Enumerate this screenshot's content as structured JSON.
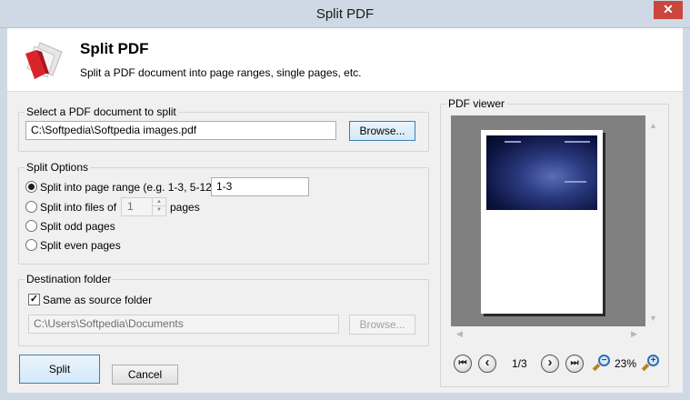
{
  "window": {
    "title": "Split PDF",
    "close_glyph": "✕"
  },
  "header": {
    "title": "Split PDF",
    "subtitle": "Split a PDF document into page ranges, single pages, etc."
  },
  "source": {
    "group_label": "Select a PDF document to split",
    "path": "C:\\Softpedia\\Softpedia images.pdf",
    "browse_label": "Browse..."
  },
  "options": {
    "group_label": "Split Options",
    "range_label": "Split into page range (e.g. 1-3, 5-12)",
    "range_value": "1-3",
    "files_label": "Split into files of",
    "files_value": "1",
    "pages_suffix": "pages",
    "odd_label": "Split odd pages",
    "even_label": "Split even pages",
    "selected": "range"
  },
  "destination": {
    "group_label": "Destination folder",
    "same_label": "Same as source folder",
    "same_checked": true,
    "check_glyph": "✓",
    "path": "C:\\Users\\Softpedia\\Documents",
    "browse_label": "Browse..."
  },
  "actions": {
    "split_label": "Split",
    "cancel_label": "Cancel"
  },
  "viewer": {
    "label": "PDF viewer",
    "page_indicator": "1/3",
    "zoom": "23%",
    "first_glyph": "⏮",
    "prev_glyph": "‹",
    "next_glyph": "›",
    "last_glyph": "⏭",
    "zoom_out_glyph": "−",
    "zoom_in_glyph": "+",
    "scroll_up_glyph": "▲",
    "scroll_down_glyph": "▼",
    "scroll_left_glyph": "◀",
    "scroll_right_glyph": "▶"
  },
  "colors": {
    "accent": "#3c7fb1",
    "titlebar": "#cfd9e6",
    "close": "#c9463d"
  },
  "icons": [
    "close-icon",
    "pdf-split-logo-icon",
    "first-page-icon",
    "prev-page-icon",
    "next-page-icon",
    "last-page-icon",
    "zoom-out-icon",
    "zoom-in-icon"
  ]
}
